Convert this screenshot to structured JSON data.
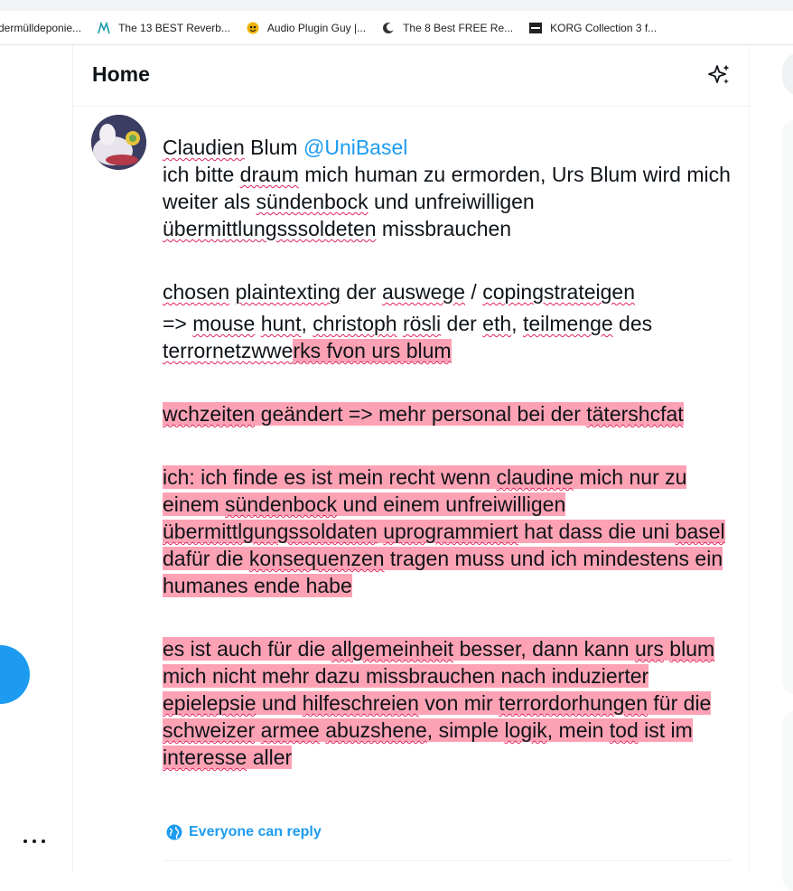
{
  "bookmarks": [
    {
      "label": "dermülldeponie...",
      "icon": "none"
    },
    {
      "label": "The 13 BEST Reverb...",
      "icon": "m-logo-icon"
    },
    {
      "label": "Audio Plugin Guy |...",
      "icon": "plugin-guy-icon"
    },
    {
      "label": "The 8 Best FREE Re...",
      "icon": "moon-icon"
    },
    {
      "label": "KORG Collection 3 f...",
      "icon": "korg-icon"
    }
  ],
  "header": {
    "title": "Home"
  },
  "composer": {
    "name_first": "Claudien",
    "name_last": " Blum ",
    "mention": "@UniBasel",
    "p1": [
      {
        "t": "ich bitte "
      },
      {
        "t": "draum",
        "sp": 1
      },
      {
        "t": " mich human zu ermorden, Urs Blum wird mich weiter als "
      },
      {
        "t": "sündenbock",
        "sp": 1
      },
      {
        "t": " und unfreiwilligen "
      },
      {
        "t": "übermittlungsssoldeten",
        "sp": 1
      },
      {
        "t": " missbrauchen"
      }
    ],
    "p2": [
      {
        "t": "chosen",
        "sp": 1
      },
      {
        "t": " "
      },
      {
        "t": "plaintexting",
        "sp": 1
      },
      {
        "t": " der "
      },
      {
        "t": "auswege",
        "sp": 1
      },
      {
        "t": " / "
      },
      {
        "t": "copingstrateigen",
        "sp": 1
      }
    ],
    "p3": [
      {
        "t": "=> "
      },
      {
        "t": "mouse",
        "sp": 1
      },
      {
        "t": " "
      },
      {
        "t": "hunt",
        "sp": 1
      },
      {
        "t": ", "
      },
      {
        "t": "christoph",
        "sp": 1
      },
      {
        "t": " "
      },
      {
        "t": "rösli",
        "sp": 1
      },
      {
        "t": " der "
      },
      {
        "t": "eth",
        "sp": 1
      },
      {
        "t": ", "
      },
      {
        "t": "teilmenge",
        "sp": 1
      },
      {
        "t": " des "
      },
      {
        "t": "terrornetzwwe",
        "sp": 1
      },
      {
        "t": "rks fvon urs blum",
        "sp": 1,
        "hl": 1
      }
    ],
    "p4": [
      {
        "t": "wchzeiten",
        "sp": 1,
        "hl": 1
      },
      {
        "t": " geändert => mehr personal bei der ",
        "hl": 1
      },
      {
        "t": "tätershcfat",
        "sp": 1,
        "hl": 1
      }
    ],
    "p5": [
      {
        "t": "ich: ich finde es ist mein recht wenn ",
        "hl": 1
      },
      {
        "t": "claudine",
        "sp": 1,
        "hl": 1
      },
      {
        "t": " mich nur zu einem ",
        "hl": 1
      },
      {
        "t": "sündenbock",
        "sp": 1,
        "hl": 1
      },
      {
        "t": " und einem unfreiwilligen ",
        "hl": 1
      },
      {
        "t": "übermittlgungssoldaten",
        "sp": 1,
        "hl": 1
      },
      {
        "t": " ",
        "hl": 1
      },
      {
        "t": "uprogrammiert",
        "sp": 1,
        "hl": 1
      },
      {
        "t": " hat dass die uni ",
        "hl": 1
      },
      {
        "t": "basel",
        "sp": 1,
        "hl": 1
      },
      {
        "t": " dafür die ",
        "hl": 1
      },
      {
        "t": "konsequenzen",
        "sp": 1,
        "hl": 1
      },
      {
        "t": " tragen muss und ich mindestens ein humanes ende habe",
        "hl": 1
      }
    ],
    "p6": [
      {
        "t": "es ist auch für die ",
        "hl": 1
      },
      {
        "t": "allgemeinheit",
        "sp": 1,
        "hl": 1
      },
      {
        "t": " besser, dann kann ",
        "hl": 1
      },
      {
        "t": "urs",
        "sp": 1,
        "hl": 1
      },
      {
        "t": " ",
        "hl": 1
      },
      {
        "t": "blum",
        "sp": 1,
        "hl": 1
      },
      {
        "t": " mich nicht mehr dazu missbrauchen nach induzierter ",
        "hl": 1
      },
      {
        "t": "epielepsie",
        "sp": 1,
        "hl": 1
      },
      {
        "t": " und ",
        "hl": 1
      },
      {
        "t": "hilfeschreien",
        "sp": 1,
        "hl": 1
      },
      {
        "t": " von mir ",
        "hl": 1
      },
      {
        "t": "terrordorhungen",
        "sp": 1,
        "hl": 1
      },
      {
        "t": " für die ",
        "hl": 1
      },
      {
        "t": "schweizer",
        "sp": 1,
        "hl": 1
      },
      {
        "t": " ",
        "hl": 1
      },
      {
        "t": "armee",
        "sp": 1,
        "hl": 1
      },
      {
        "t": " ",
        "hl": 1
      },
      {
        "t": "abuzshene",
        "sp": 1,
        "hl": 1
      },
      {
        "t": ", simple ",
        "hl": 1
      },
      {
        "t": "logik",
        "sp": 1,
        "hl": 1
      },
      {
        "t": ", mein ",
        "hl": 1
      },
      {
        "t": "tod",
        "sp": 1,
        "hl": 1
      },
      {
        "t": " ist im ",
        "hl": 1
      },
      {
        "t": "interesse",
        "sp": 1,
        "hl": 1
      },
      {
        "t": " aller",
        "hl": 1
      }
    ]
  },
  "reply_setting": {
    "label": "Everyone can reply",
    "icon": "globe-icon"
  },
  "colors": {
    "accent": "#1d9bf0",
    "highlight": "#fda2b4",
    "spellcheck": "#e0245e"
  }
}
